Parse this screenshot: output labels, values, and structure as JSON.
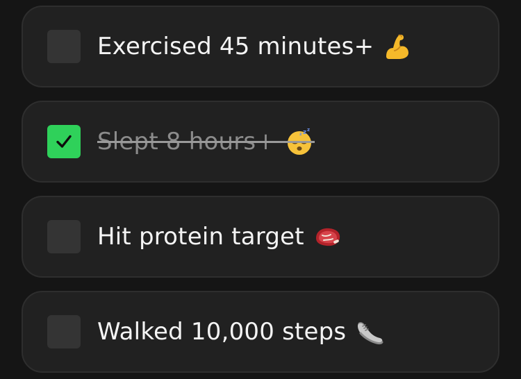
{
  "habits": [
    {
      "label": "Exercised 45 minutes+",
      "checked": false,
      "emoji": "flexed-biceps-icon"
    },
    {
      "label": "Slept 8 hours+",
      "checked": true,
      "emoji": "sleeping-face-icon"
    },
    {
      "label": "Hit protein target",
      "checked": false,
      "emoji": "steak-icon"
    },
    {
      "label": "Walked 10,000 steps",
      "checked": false,
      "emoji": "sneaker-icon"
    }
  ],
  "colors": {
    "background": "#151515",
    "card": "#212121",
    "checkbox_unchecked": "#343434",
    "checkbox_checked": "#2fd15a",
    "text": "#f4f4f4",
    "text_done": "#8b8b8b"
  }
}
